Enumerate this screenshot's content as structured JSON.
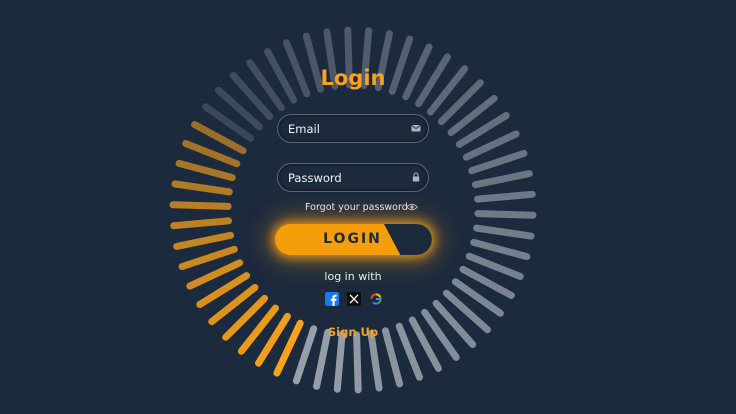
{
  "login_form": {
    "title": "Login",
    "email": {
      "placeholder": "Email",
      "icon": "envelope-icon"
    },
    "password": {
      "placeholder": "Password",
      "icon": "lock-icon"
    },
    "forgot_label": "Forgot your password",
    "eye_icon": "eye-icon",
    "submit_label": "LOGIN",
    "social_prompt": "log in with",
    "social_providers": [
      "facebook",
      "x",
      "google"
    ],
    "signup_label": "Sign Up"
  },
  "loading_ring": {
    "progress": 0.27,
    "active_color": "#f9a21b",
    "inactive_color": "#9aa3ad"
  },
  "colors": {
    "background": "#1c2a3d",
    "accent": "#f7a21b",
    "facebook": "#1877f2"
  }
}
